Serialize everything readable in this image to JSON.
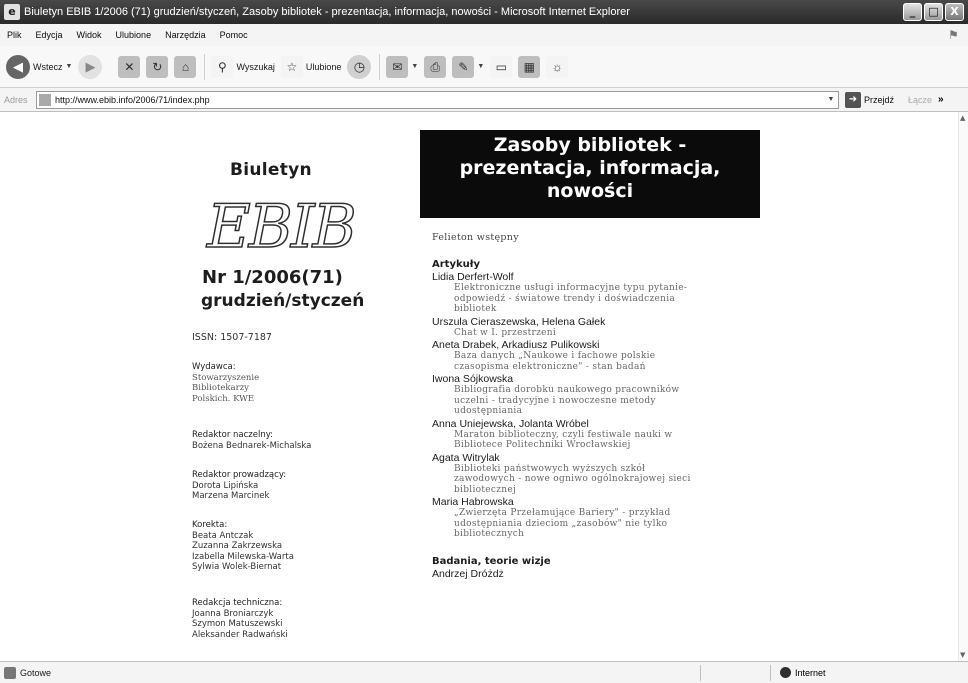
{
  "window": {
    "title": "Biuletyn EBIB 1/2006 (71) grudzień/styczeń, Zasoby bibliotek - prezentacja, informacja, nowości - Microsoft Internet Explorer",
    "minimize": "_",
    "maximize": "□",
    "close": "X"
  },
  "menu": [
    "Plik",
    "Edycja",
    "Widok",
    "Ulubione",
    "Narzędzia",
    "Pomoc"
  ],
  "toolbar": {
    "back": "Wstecz",
    "search": "Wyszukaj",
    "favorites": "Ulubione"
  },
  "address": {
    "label": "Adres",
    "url": "http://www.ebib.info/2006/71/index.php",
    "go": "Przejdź",
    "links": "Łącze"
  },
  "sidebar": {
    "biuletyn": "Biuletyn",
    "logo": "EBIB",
    "issue": "Nr 1/2006(71)",
    "date": "grudzień/styczeń",
    "issn": "ISSN: 1507-7187",
    "publisher_label": "Wydawca:",
    "publisher": [
      "Stowarzyszenie",
      "Bibliotekarzy",
      "Polskich. KWE"
    ],
    "editor_label": "Redaktor naczelny:",
    "editor": "Bożena Bednarek-Michalska",
    "lead_editors_label": "Redaktor prowadzący:",
    "lead_editors": [
      "Dorota Lipińska",
      "Marzena Marcinek"
    ],
    "proof_label": "Korekta:",
    "proof": [
      "Beata Antczak",
      "Zuzanna Zakrzewska",
      "Izabella Milewska-Warta",
      "Sylwia Wolek-Biernat"
    ],
    "tech_label": "Redakcja techniczna:",
    "tech": [
      "Joanna Broniarczyk",
      "Szymon Matuszewski",
      "Aleksander Radwański"
    ]
  },
  "banner": [
    "Zasoby bibliotek -",
    "prezentacja, informacja,",
    "nowości"
  ],
  "toc": {
    "feuilleton": "Felieton wstępny",
    "articles_heading": "Artykuły",
    "articles": [
      {
        "author": "Lidia Derfert-Wolf",
        "title": [
          "Elektroniczne usługi informacyjne typu pytanie-",
          "odpowiedź - światowe trendy i doświadczenia",
          "bibliotek"
        ]
      },
      {
        "author": "Urszula Cieraszewska, Helena Gałek",
        "title": [
          "Chat w I. przestrzeni"
        ]
      },
      {
        "author": "Aneta Drabek, Arkadiusz Pulikowski",
        "title": [
          "Baza danych „Naukowe i fachowe polskie",
          "czasopisma elektroniczne\" - stan badań"
        ]
      },
      {
        "author": "Iwona Sójkowska",
        "title": [
          "Bibliografia dorobku naukowego pracowników",
          "uczelni - tradycyjne i nowoczesne metody",
          "udostępniania"
        ]
      },
      {
        "author": "Anna Uniejewska, Jolanta Wróbel",
        "title": [
          "Maraton biblioteczny, czyli festiwale nauki w",
          "Bibliotece Politechniki Wrocławskiej"
        ]
      },
      {
        "author": "Agata Witrylak",
        "title": [
          "Biblioteki państwowych wyższych szkół",
          "zawodowych - nowe ogniwo ogólnokrajowej sieci",
          "bibliotecznej"
        ]
      },
      {
        "author": "Maria Habrowska",
        "title": [
          "„Zwierzęta Przełamujące Bariery\" - przykład",
          "udostępniania dzieciom „zasobów\" nie tylko",
          "bibliotecznych"
        ]
      }
    ],
    "research_heading": "Badania, teorie wizje",
    "research_author": "Andrzej Dróżdż"
  },
  "status": {
    "text": "Gotowe",
    "zone": "Internet"
  }
}
